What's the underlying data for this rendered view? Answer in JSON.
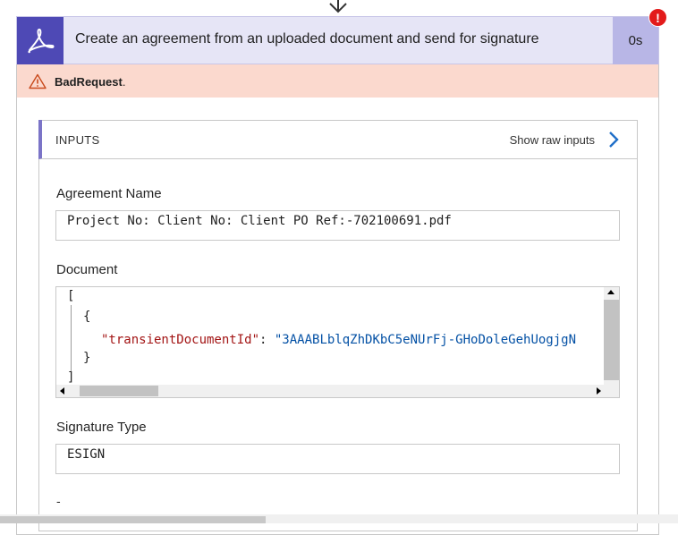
{
  "action": {
    "title": "Create an agreement from an uploaded document and send for signature",
    "duration": "0s",
    "error_badge": "!",
    "brand_color": "#4e49b5",
    "icon": "adobe-acrobat-icon"
  },
  "error": {
    "code": "BadRequest",
    "punct": ".",
    "icon": "warning-triangle-icon"
  },
  "inputs": {
    "heading": "INPUTS",
    "show_raw_label": "Show raw inputs",
    "fields": {
      "agreement_name": {
        "label": "Agreement Name",
        "value": "Project No: Client No: Client PO Ref:-702100691.pdf"
      },
      "document": {
        "label": "Document",
        "lines": {
          "open_bracket": "[",
          "open_brace": "{",
          "key": "\"transientDocumentId\"",
          "colon": ": ",
          "value": "\"3AAABLblqZhDKbC5eNUrFj-GHoDoleGehUogjgN",
          "close_brace": "}",
          "close_bracket": "]"
        }
      },
      "signature_type": {
        "label": "Signature Type",
        "value": "ESIGN"
      },
      "next_field_value": "-"
    }
  }
}
